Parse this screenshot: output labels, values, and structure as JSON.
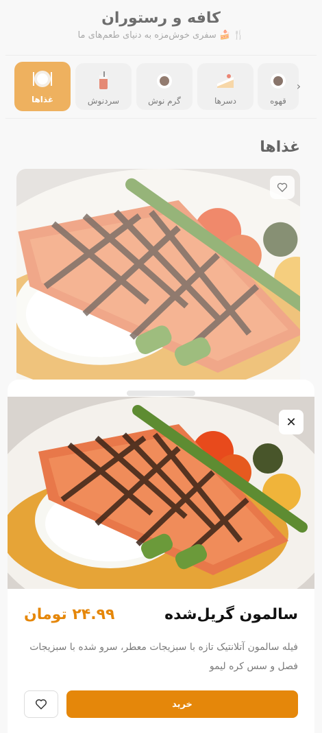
{
  "header": {
    "title": "کافه و رستوران",
    "subtitle": "🍴 🍰 سفری خوش‌مزه به دنیای طعم‌های ما"
  },
  "categories": [
    {
      "label": "غذاها",
      "icon": "plate-icon",
      "active": true
    },
    {
      "label": "سردنوش",
      "icon": "cold-drink-icon",
      "active": false
    },
    {
      "label": "گرم نوش",
      "icon": "hot-drink-icon",
      "active": false
    },
    {
      "label": "دسرها",
      "icon": "cake-icon",
      "active": false
    },
    {
      "label": "قهوه",
      "icon": "coffee-icon",
      "active": false
    }
  ],
  "section": {
    "title": "غذاها"
  },
  "item": {
    "name": "سالمون گریل‌شده",
    "price": "۲۴.۹۹ تومان",
    "description": "فیله سالمون آتلانتیک تازه با سبزیجات معطر، سرو شده با سبزیجات فصل و سس کره لیمو",
    "buy_label": "خرید"
  },
  "colors": {
    "accent": "#e5870a",
    "background": "#f5f5f5"
  }
}
